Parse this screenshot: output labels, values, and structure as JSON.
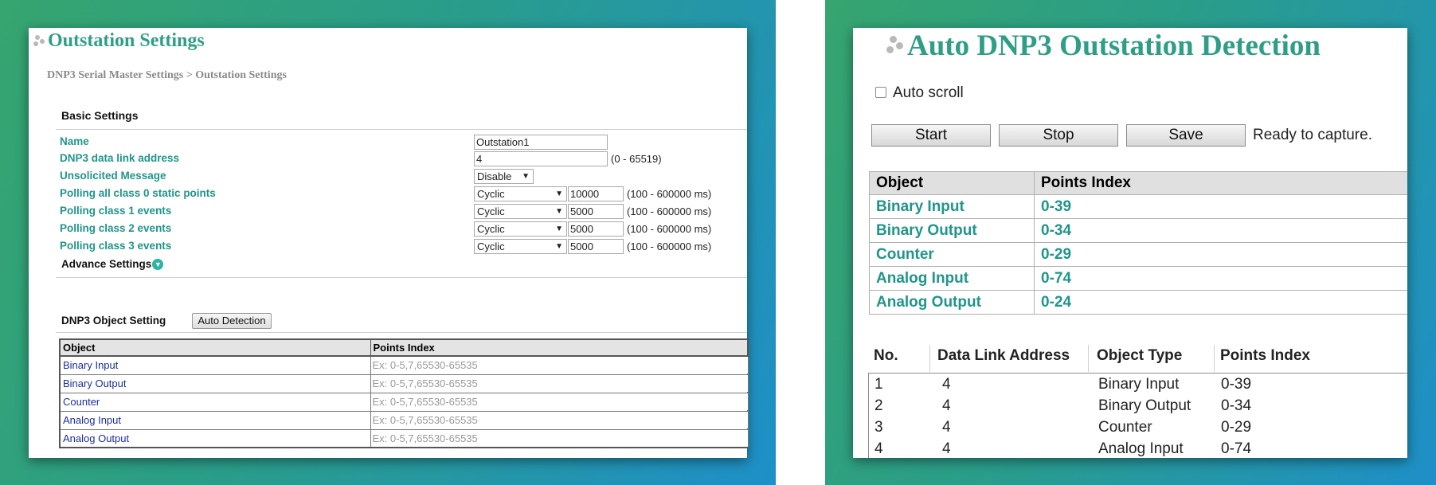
{
  "left": {
    "title": "Outstation Settings",
    "breadcrumb": "DNP3 Serial Master Settings > Outstation Settings",
    "basic_settings": "Basic Settings",
    "fields": {
      "name": {
        "label": "Name",
        "value": "Outstation1"
      },
      "link_addr": {
        "label": "DNP3 data link address",
        "value": "4",
        "range": "(0 - 65519)"
      },
      "unsolicited": {
        "label": "Unsolicited Message",
        "value": "Disable"
      },
      "class0": {
        "label": "Polling all class 0 static points",
        "mode": "Cyclic",
        "value": "10000",
        "range": "(100 - 600000 ms)"
      },
      "class1": {
        "label": "Polling class 1 events",
        "mode": "Cyclic",
        "value": "5000",
        "range": "(100 - 600000 ms)"
      },
      "class2": {
        "label": "Polling class 2 events",
        "mode": "Cyclic",
        "value": "5000",
        "range": "(100 - 600000 ms)"
      },
      "class3": {
        "label": "Polling class 3 events",
        "mode": "Cyclic",
        "value": "5000",
        "range": "(100 - 600000 ms)"
      }
    },
    "advance_settings": "Advance Settings",
    "object_setting": "DNP3 Object Setting",
    "auto_detection": "Auto Detection",
    "table_headers": {
      "object": "Object",
      "points": "Points Index"
    },
    "placeholder": "Ex: 0-5,7,65530-65535",
    "objects": [
      "Binary Input",
      "Binary Output",
      "Counter",
      "Analog Input",
      "Analog Output"
    ]
  },
  "right": {
    "title": "Auto DNP3 Outstation Detection",
    "auto_scroll": "Auto scroll",
    "buttons": {
      "start": "Start",
      "stop": "Stop",
      "save": "Save"
    },
    "status": "Ready to capture.",
    "table_headers": {
      "object": "Object",
      "points": "Points Index"
    },
    "objects": [
      {
        "name": "Binary Input",
        "points": "0-39"
      },
      {
        "name": "Binary Output",
        "points": "0-34"
      },
      {
        "name": "Counter",
        "points": "0-29"
      },
      {
        "name": "Analog Input",
        "points": "0-74"
      },
      {
        "name": "Analog Output",
        "points": "0-24"
      }
    ],
    "result_headers": {
      "no": "No.",
      "addr": "Data Link Address",
      "type": "Object Type",
      "points": "Points Index"
    },
    "results": [
      {
        "no": "1",
        "addr": "4",
        "type": "Binary Input",
        "points": "0-39"
      },
      {
        "no": "2",
        "addr": "4",
        "type": "Binary Output",
        "points": "0-34"
      },
      {
        "no": "3",
        "addr": "4",
        "type": "Counter",
        "points": "0-29"
      },
      {
        "no": "4",
        "addr": "4",
        "type": "Analog Input",
        "points": "0-74"
      }
    ]
  },
  "colors": {
    "accent": "#2e9e87",
    "label": "#21958a",
    "link": "#1b2fa0"
  }
}
